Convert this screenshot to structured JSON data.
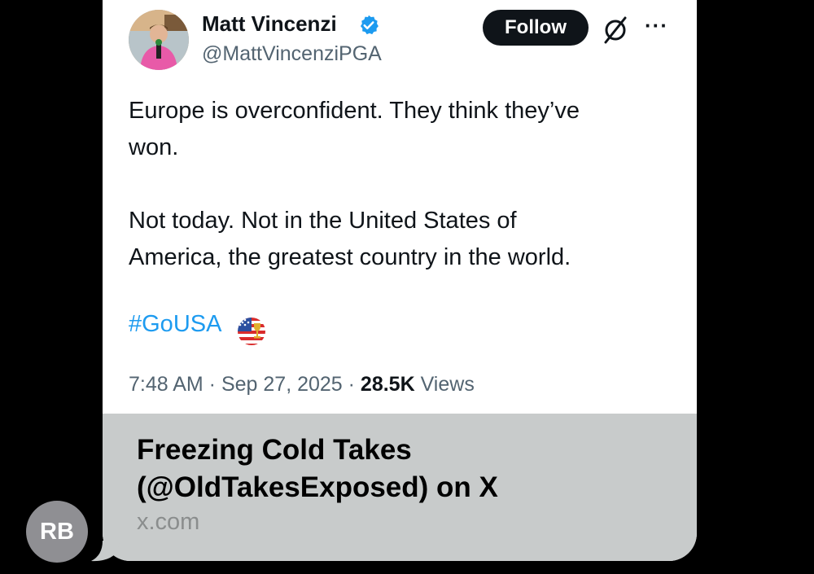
{
  "tweet": {
    "author_name": "Matt Vincenzi",
    "handle": "@MattVincenziPGA",
    "follow_label": "Follow",
    "more_label": "···",
    "text": "Europe is overconfident. They think they’ve\nwon.\n\nNot today. Not in the United States of\nAmerica, the greatest country in the world.",
    "hashtag": "#GoUSA",
    "time": "7:48 AM",
    "sep1": " · ",
    "date": "Sep 27, 2025",
    "sep2": " · ",
    "views_count": "28.5K",
    "views_label": " Views"
  },
  "link_card": {
    "title": "Freezing Cold Takes\n(@OldTakesExposed) on X",
    "domain": "x.com"
  },
  "sender": {
    "initials": "RB"
  },
  "colors": {
    "background": "#000000",
    "card_bg": "#ffffff",
    "link_card_bg": "#c8cbcb",
    "hashtag": "#1d9bf0",
    "verified": "#1d9bf0",
    "follow_bg": "#0f1419",
    "secondary_text": "#536471",
    "avatar_rb": "#8f8f93"
  },
  "icons": {
    "verified": "verified-badge-icon",
    "grok": "grok-icon",
    "more": "more-options-icon",
    "flag": "usa-flag-emoji"
  }
}
